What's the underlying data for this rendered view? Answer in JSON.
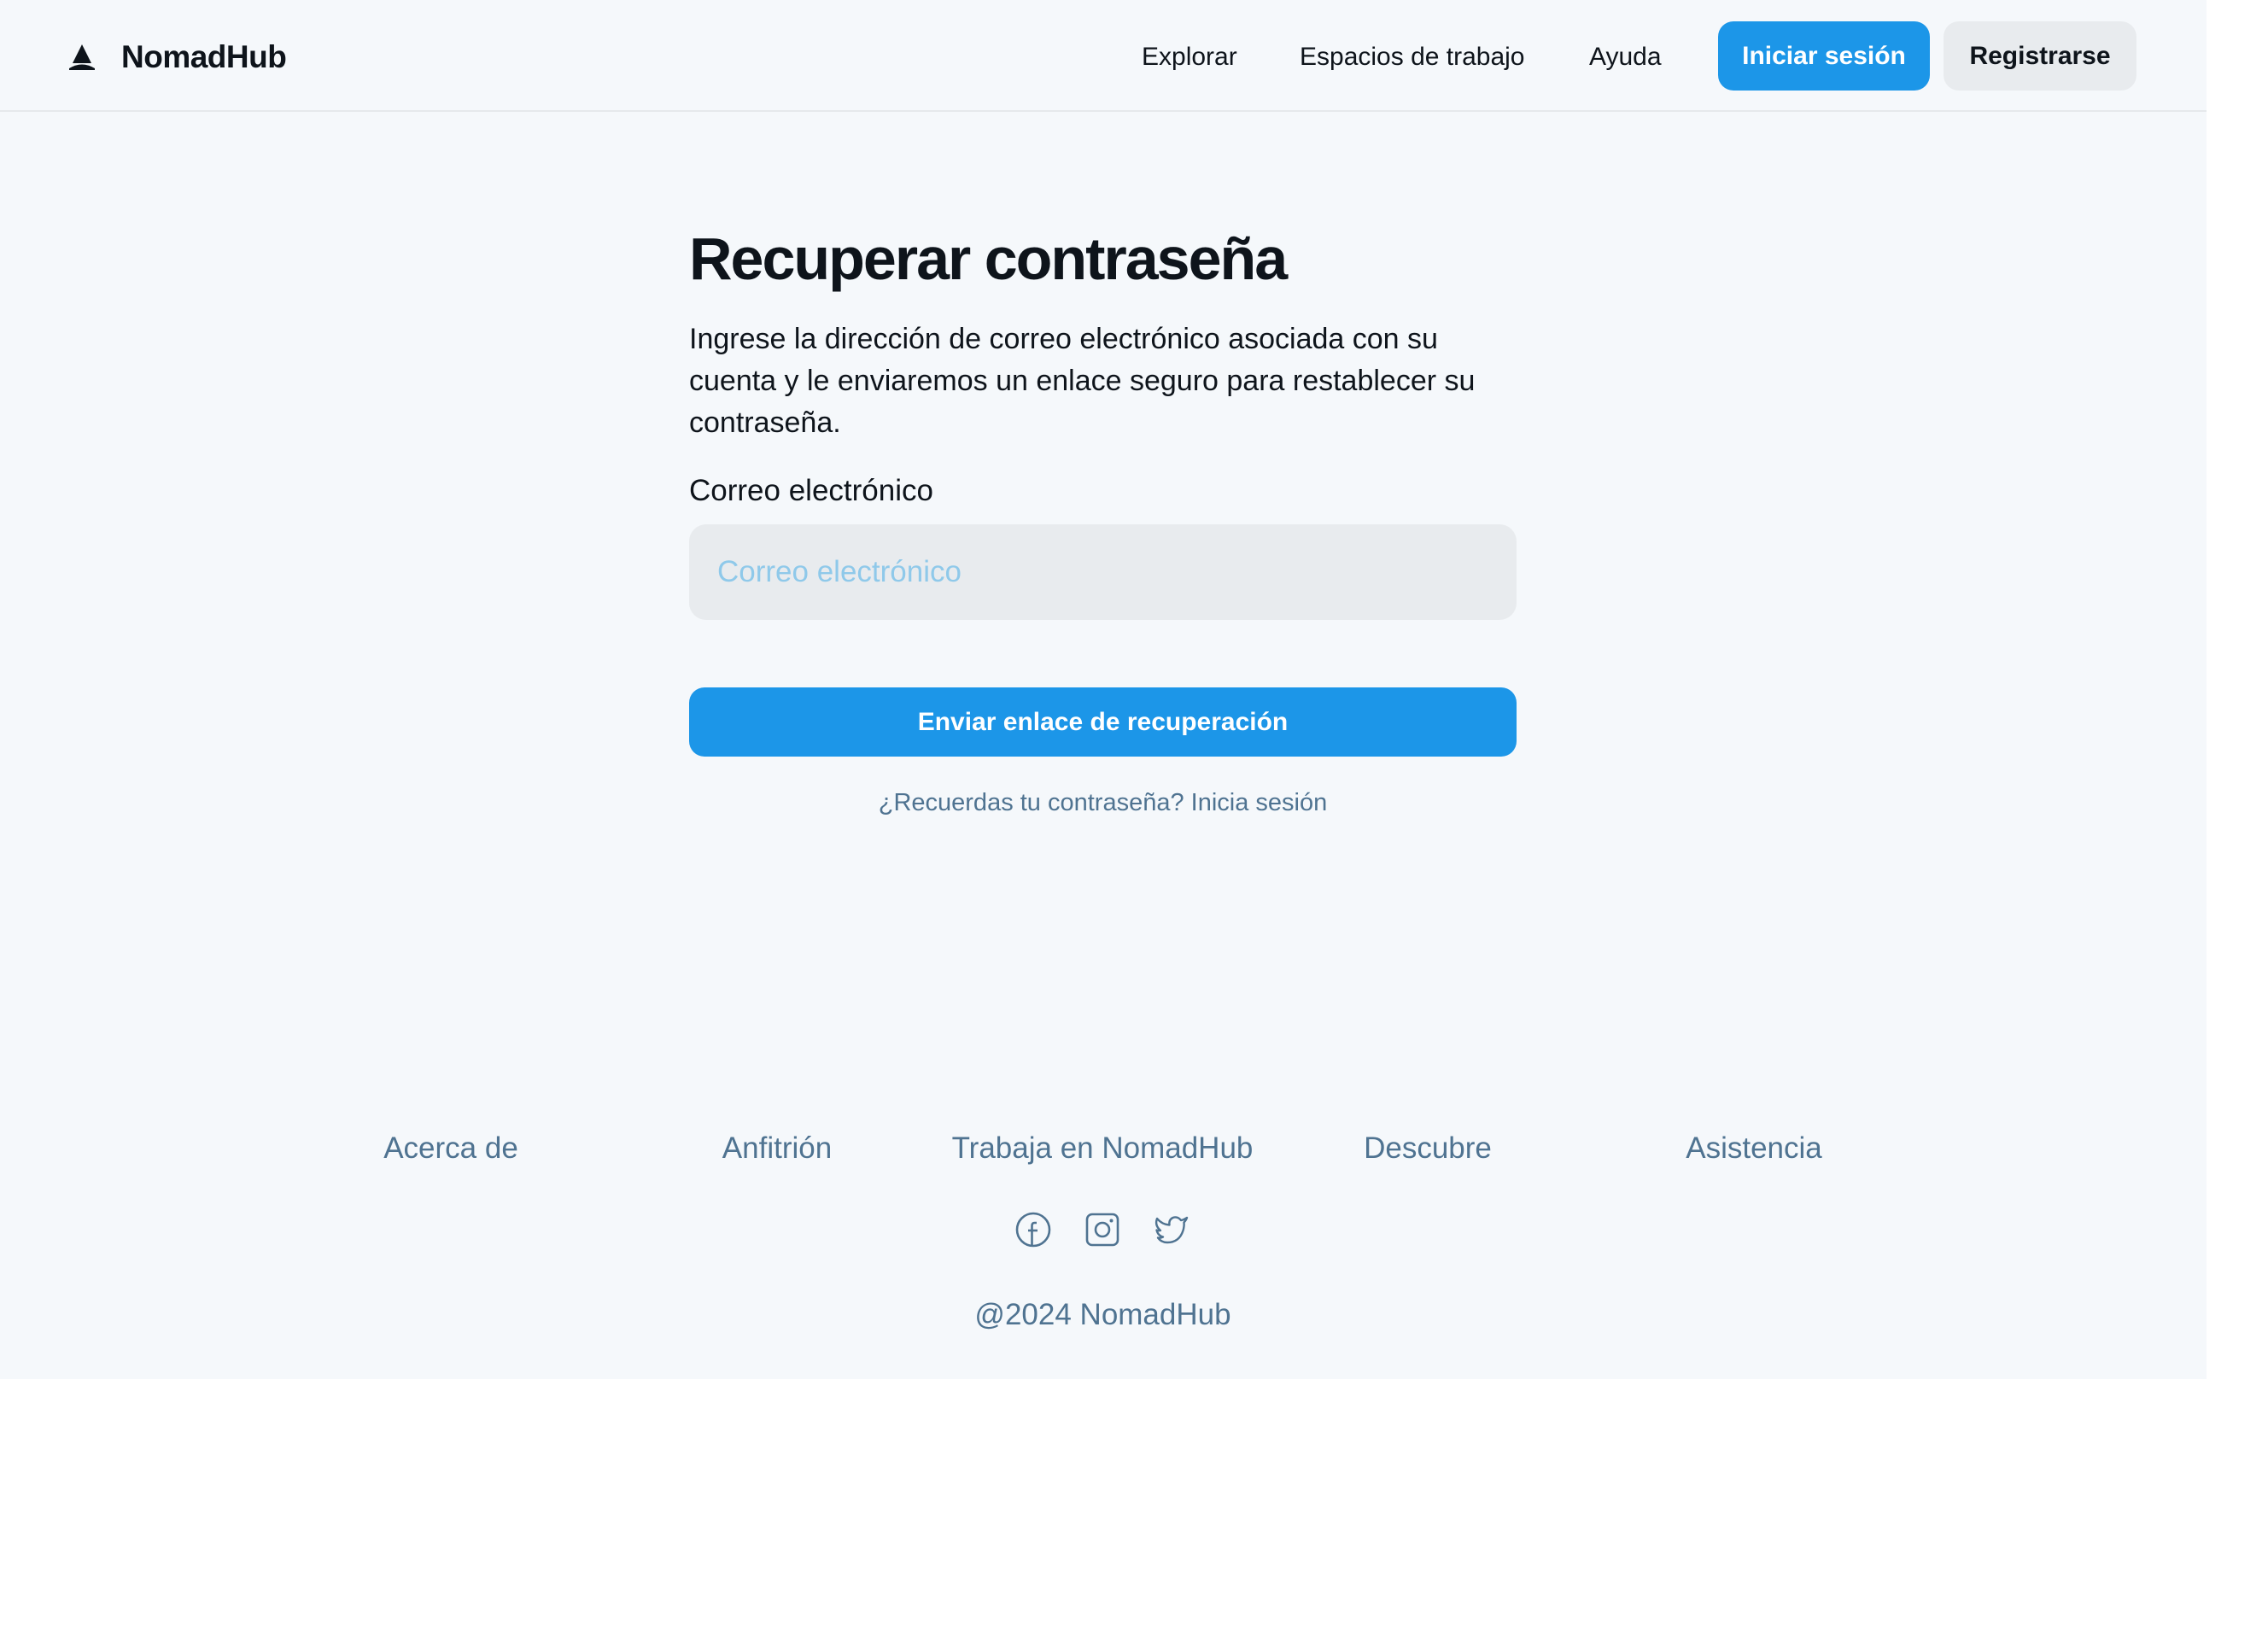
{
  "header": {
    "brand_name": "NomadHub",
    "brand_icon": "mountain-logo-icon",
    "nav": [
      "Explorar",
      "Espacios de trabajo",
      "Ayuda"
    ],
    "login_label": "Iniciar sesión",
    "register_label": "Registrarse"
  },
  "main": {
    "title": "Recuperar contraseña",
    "description": "Ingrese la dirección de correo electrónico asociada con su cuenta y le enviaremos un enlace seguro para restablecer su contraseña.",
    "email_label": "Correo electrónico",
    "email_placeholder": "Correo electrónico",
    "email_value": "",
    "submit_label": "Enviar enlace de recuperación",
    "remember_link": "¿Recuerdas tu contraseña? Inicia sesión"
  },
  "footer": {
    "links": [
      "Acerca de",
      "Anfitrión",
      "Trabaja en NomadHub",
      "Descubre",
      "Asistencia"
    ],
    "social_icons": [
      "facebook-icon",
      "instagram-icon",
      "twitter-icon"
    ],
    "copyright": "@2024 NomadHub"
  },
  "colors": {
    "primary": "#1c96e8",
    "background": "#f5f8fb",
    "secondary_button": "#e8ebee",
    "text": "#0e141b",
    "muted_text": "#4f7391",
    "placeholder": "#8fc9ea"
  }
}
